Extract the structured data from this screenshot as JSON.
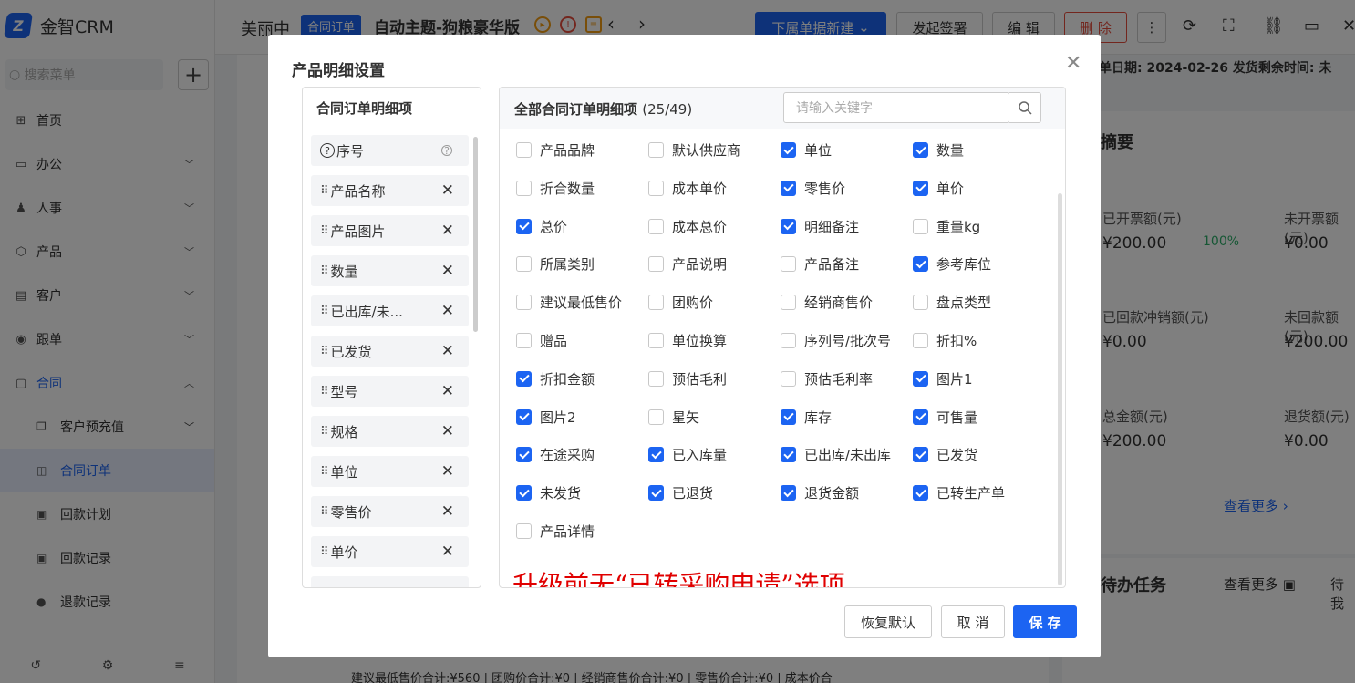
{
  "app": {
    "brand": "金智CRM",
    "search_placeholder": "搜索菜单"
  },
  "sidebar": {
    "items": [
      {
        "label": "首页",
        "icon": "home-icon",
        "glyph": "⊞"
      },
      {
        "label": "办公",
        "icon": "office-icon",
        "glyph": "▭"
      },
      {
        "label": "人事",
        "icon": "people-icon",
        "glyph": "♟"
      },
      {
        "label": "产品",
        "icon": "product-icon",
        "glyph": "⬡"
      },
      {
        "label": "客户",
        "icon": "customer-icon",
        "glyph": "▤"
      },
      {
        "label": "跟单",
        "icon": "followup-icon",
        "glyph": "◉"
      },
      {
        "label": "合同",
        "icon": "contract-icon",
        "glyph": "▢"
      }
    ],
    "subitems": [
      {
        "label": "客户预充值",
        "glyph": "❐"
      },
      {
        "label": "合同订单",
        "glyph": "◫"
      },
      {
        "label": "回款计划",
        "glyph": "▣"
      },
      {
        "label": "回款记录",
        "glyph": "▣"
      },
      {
        "label": "退款记录",
        "glyph": "●"
      }
    ]
  },
  "topbar": {
    "doc_title": "美丽中",
    "tag": "合同订单",
    "record_name": "自动主题-狗粮豪华版",
    "sub_new": "下属单据新建",
    "sign": "发起签署",
    "edit": "编 辑",
    "delete": "删 除"
  },
  "right_info": {
    "label": "单日期:",
    "date": "2024-02-26",
    "label2": "发货剩余时间:",
    "rest": "未",
    "summary": "摘要",
    "stats": [
      {
        "label": "已开票额(元)",
        "value": "¥200.00",
        "pct": "100%"
      },
      {
        "label": "未开票额(元)",
        "value": "¥0.00"
      },
      {
        "label": "已回款冲销额(元)",
        "value": "¥0.00"
      },
      {
        "label": "未回款额(元)",
        "value": "¥200.00"
      },
      {
        "label": "总金额(元)",
        "value": "¥200.00"
      },
      {
        "label": "退货额(元)",
        "value": "¥0.00"
      }
    ],
    "more": "查看更多",
    "todo": "待办任务",
    "todo_more": "查看更多",
    "todo_right": "待我"
  },
  "bottom_summary": "建议最低售价合计:¥560 | 团购价合计:¥0 | 经销商售价合计:¥0 | 零售价合计:¥0 | 成本价合",
  "modal": {
    "title": "产品明细设置",
    "left_title": "合同订单明细项",
    "left_items": [
      {
        "label": "序号",
        "fixed": true
      },
      {
        "label": "产品名称"
      },
      {
        "label": "产品图片"
      },
      {
        "label": "数量"
      },
      {
        "label": "已出库/未..."
      },
      {
        "label": "已发货"
      },
      {
        "label": "型号"
      },
      {
        "label": "规格"
      },
      {
        "label": "单位"
      },
      {
        "label": "零售价"
      },
      {
        "label": "单价"
      }
    ],
    "right_title": "全部合同订单明细项",
    "right_count": "(25/49)",
    "search_placeholder": "请输入关键字",
    "options": [
      {
        "label": "产品品牌",
        "checked": false
      },
      {
        "label": "默认供应商",
        "checked": false
      },
      {
        "label": "单位",
        "checked": true
      },
      {
        "label": "数量",
        "checked": true
      },
      {
        "label": "折合数量",
        "checked": false
      },
      {
        "label": "成本单价",
        "checked": false
      },
      {
        "label": "零售价",
        "checked": true
      },
      {
        "label": "单价",
        "checked": true
      },
      {
        "label": "总价",
        "checked": true
      },
      {
        "label": "成本总价",
        "checked": false
      },
      {
        "label": "明细备注",
        "checked": true
      },
      {
        "label": "重量kg",
        "checked": false
      },
      {
        "label": "所属类别",
        "checked": false
      },
      {
        "label": "产品说明",
        "checked": false
      },
      {
        "label": "产品备注",
        "checked": false
      },
      {
        "label": "参考库位",
        "checked": true
      },
      {
        "label": "建议最低售价",
        "checked": false
      },
      {
        "label": "团购价",
        "checked": false
      },
      {
        "label": "经销商售价",
        "checked": false
      },
      {
        "label": "盘点类型",
        "checked": false
      },
      {
        "label": "赠品",
        "checked": false
      },
      {
        "label": "单位换算",
        "checked": false
      },
      {
        "label": "序列号/批次号",
        "checked": false
      },
      {
        "label": "折扣%",
        "checked": false
      },
      {
        "label": "折扣金额",
        "checked": true
      },
      {
        "label": "预估毛利",
        "checked": false
      },
      {
        "label": "预估毛利率",
        "checked": false
      },
      {
        "label": "图片1",
        "checked": true
      },
      {
        "label": "图片2",
        "checked": true
      },
      {
        "label": "星矢",
        "checked": false
      },
      {
        "label": "库存",
        "checked": true
      },
      {
        "label": "可售量",
        "checked": true
      },
      {
        "label": "在途采购",
        "checked": true
      },
      {
        "label": "已入库量",
        "checked": true
      },
      {
        "label": "已出库/未出库",
        "checked": true
      },
      {
        "label": "已发货",
        "checked": true
      },
      {
        "label": "未发货",
        "checked": true
      },
      {
        "label": "已退货",
        "checked": true
      },
      {
        "label": "退货金额",
        "checked": true
      },
      {
        "label": "已转生产单",
        "checked": true
      },
      {
        "label": "产品详情",
        "checked": false
      }
    ],
    "annotation": "升级前无“已转采购申请”选项",
    "reset": "恢复默认",
    "cancel": "取 消",
    "save": "保 存"
  }
}
